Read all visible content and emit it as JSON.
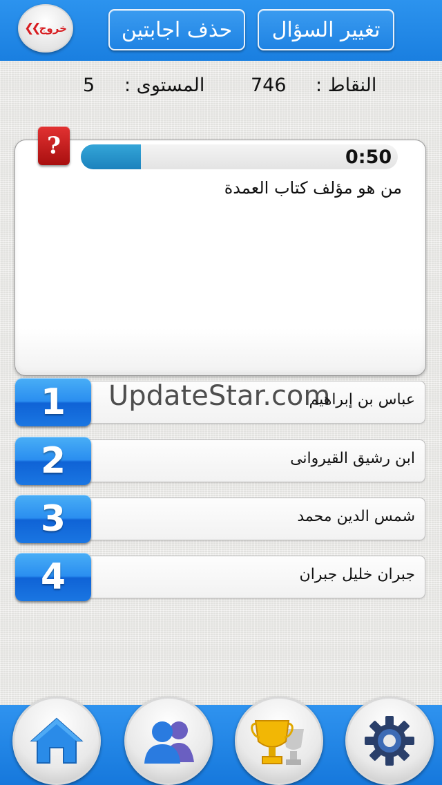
{
  "header": {
    "exit_label": "خروج",
    "remove_two_label": "حذف اجابتين",
    "change_question_label": "تغيير السؤال"
  },
  "stats": {
    "points_label": "النقاط :",
    "points_value": "746",
    "level_label": "المستوى :",
    "level_value": "5"
  },
  "question": {
    "timer": "0:50",
    "progress_fraction": 0.19,
    "text": "من هو مؤلف كتاب العمدة",
    "help_icon_symbol": "?"
  },
  "answers": [
    {
      "number": "1",
      "text": "عباس بن إبراهيم"
    },
    {
      "number": "2",
      "text": "ابن رشيق القيروانى"
    },
    {
      "number": "3",
      "text": "شمس الدين محمد"
    },
    {
      "number": "4",
      "text": "جبران خليل جبران"
    }
  ],
  "watermark": "UpdateStar.com",
  "nav": {
    "icons": [
      "home-icon",
      "friends-icon",
      "trophy-icon",
      "settings-icon"
    ]
  },
  "colors": {
    "primary_blue": "#1f83e3",
    "exit_red": "#d71c20",
    "help_red": "#c41d1d",
    "progress_blue": "#2594cf"
  }
}
